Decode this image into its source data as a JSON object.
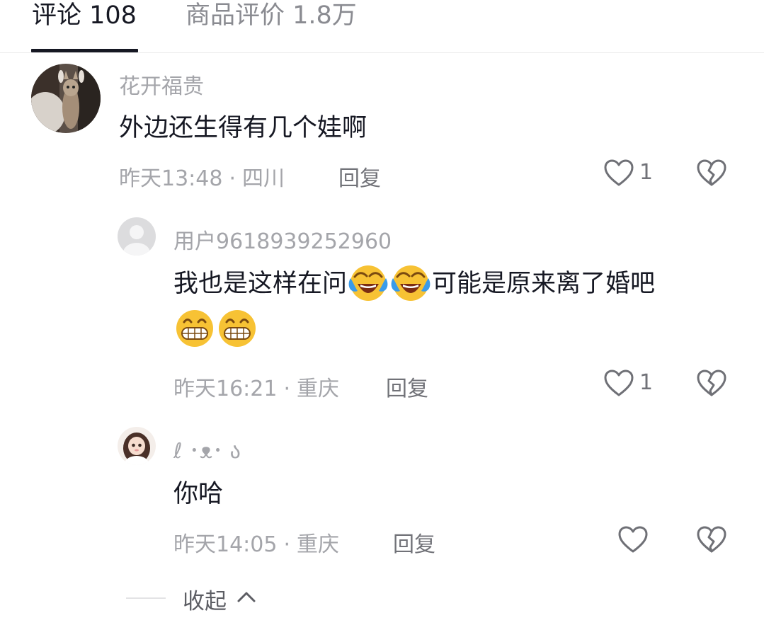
{
  "tabs": [
    {
      "label": "评论 108",
      "active": true
    },
    {
      "label": "商品评价 1.8万",
      "active": false
    }
  ],
  "comments": [
    {
      "username": "花开福贵",
      "text": "外边还生得有几个娃啊",
      "time": "昨天13:48",
      "location": "四川",
      "reply_label": "回复",
      "likes": "1"
    },
    {
      "username": "用户9618939252960",
      "text_parts": [
        "我也是这样在问",
        "可能是原来离了婚吧"
      ],
      "emoji_inline": "crying-laughing-emoji",
      "emoji_trailing": "grinning-emoji",
      "time": "昨天16:21",
      "location": "重庆",
      "reply_label": "回复",
      "likes": "1"
    },
    {
      "username": "ℓ ･ᴥ･ ა",
      "text": "你哈",
      "time": "昨天14:05",
      "location": "重庆",
      "reply_label": "回复",
      "likes": ""
    }
  ],
  "collapse_label": "收起",
  "colors": {
    "primary_text": "#161823",
    "secondary_text": "#a4a5aa",
    "icon": "#6f7076"
  }
}
